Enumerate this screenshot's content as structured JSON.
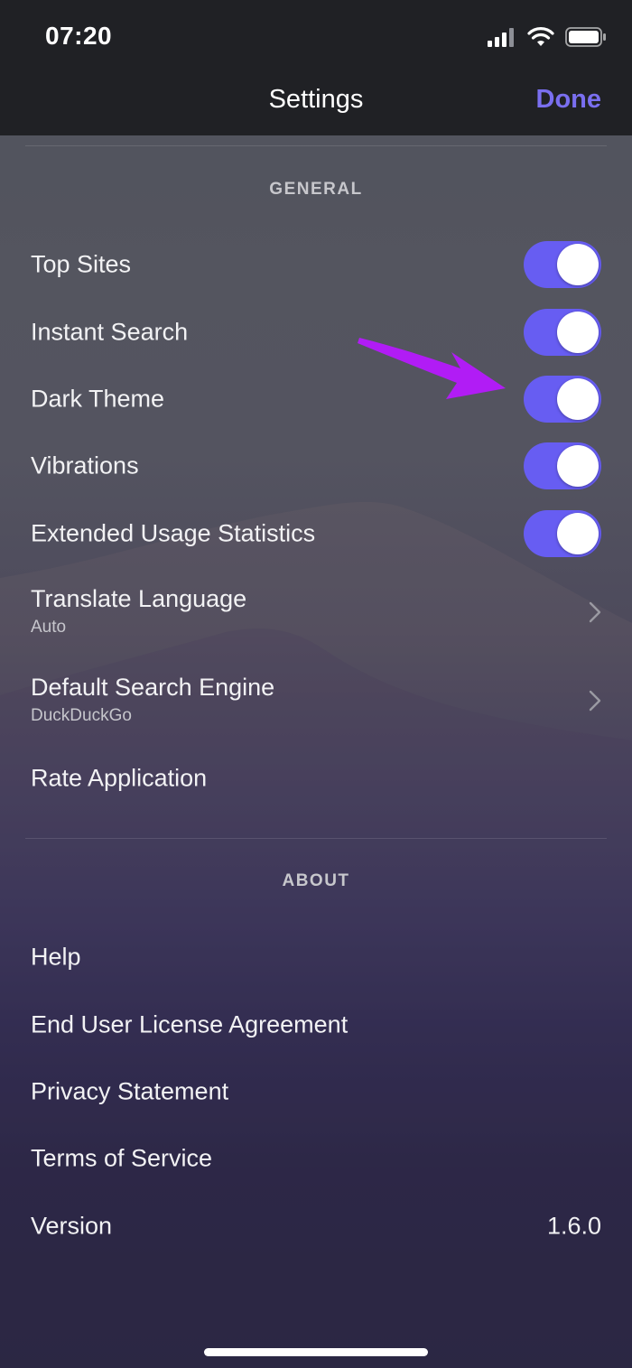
{
  "status_bar": {
    "time": "07:20"
  },
  "nav": {
    "title": "Settings",
    "done_label": "Done"
  },
  "sections": {
    "general": {
      "header": "GENERAL",
      "toggles": [
        {
          "label": "Top Sites",
          "on": true
        },
        {
          "label": "Instant Search",
          "on": true
        },
        {
          "label": "Dark Theme",
          "on": true
        },
        {
          "label": "Vibrations",
          "on": true
        },
        {
          "label": "Extended Usage Statistics",
          "on": true
        }
      ],
      "translate": {
        "label": "Translate Language",
        "value": "Auto"
      },
      "search_engine": {
        "label": "Default Search Engine",
        "value": "DuckDuckGo"
      },
      "rate": {
        "label": "Rate Application"
      }
    },
    "about": {
      "header": "ABOUT",
      "items": [
        "Help",
        "End User License Agreement",
        "Privacy Statement",
        "Terms of Service"
      ],
      "version": {
        "label": "Version",
        "value": "1.6.0"
      }
    }
  },
  "colors": {
    "accent": "#7a6ff0",
    "toggle_on": "#675df2",
    "annotation_arrow": "#b11cf5"
  },
  "icons": [
    "signal-icon",
    "wifi-icon",
    "battery-icon",
    "chevron-right-icon",
    "annotation-arrow"
  ]
}
